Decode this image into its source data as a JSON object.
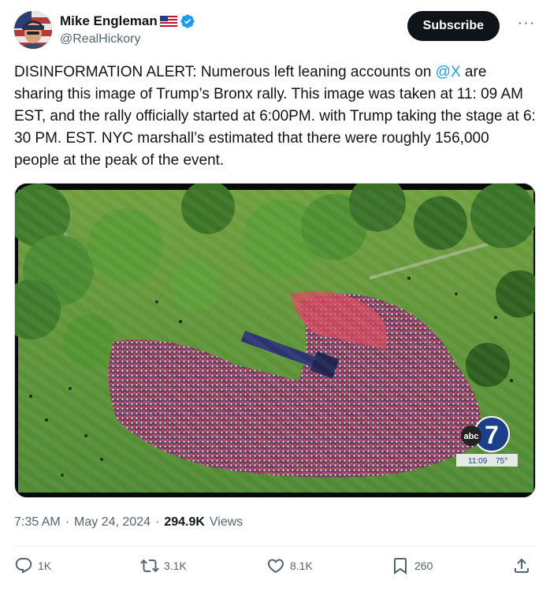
{
  "author": {
    "display_name": "Mike Engleman",
    "handle": "@RealHickory",
    "flag_icon": "us-flag-icon",
    "verified_icon": "verified-badge-icon",
    "verified_color": "#1d9bf0"
  },
  "header": {
    "subscribe_label": "Subscribe",
    "more_label": "···"
  },
  "tweet": {
    "text_before": "DISINFORMATION ALERT: Numerous left leaning accounts on ",
    "mention": "@X",
    "text_after": " are sharing this image of Trump’s Bronx rally. This image was taken at 11: 09 AM EST, and the rally officially started at 6:00PM. with Trump taking the stage at 6: 30 PM. EST. NYC marshall’s estimated that there were roughly 156,000 people at the peak of the event."
  },
  "media": {
    "channel_logo_text": "abc",
    "channel_number": "7",
    "time_readout": "11:09",
    "temp_readout": "75°"
  },
  "meta": {
    "time": "7:35 AM",
    "separator": "·",
    "date": "May 24, 2024",
    "views_count": "294.9K",
    "views_label": "Views"
  },
  "actions": {
    "replies": "1K",
    "reposts": "3.1K",
    "likes": "8.1K",
    "bookmarks": "260"
  },
  "colors": {
    "text": "#0f1419",
    "secondary": "#536471",
    "link": "#1d9bf0",
    "button_bg": "#0f1419"
  }
}
